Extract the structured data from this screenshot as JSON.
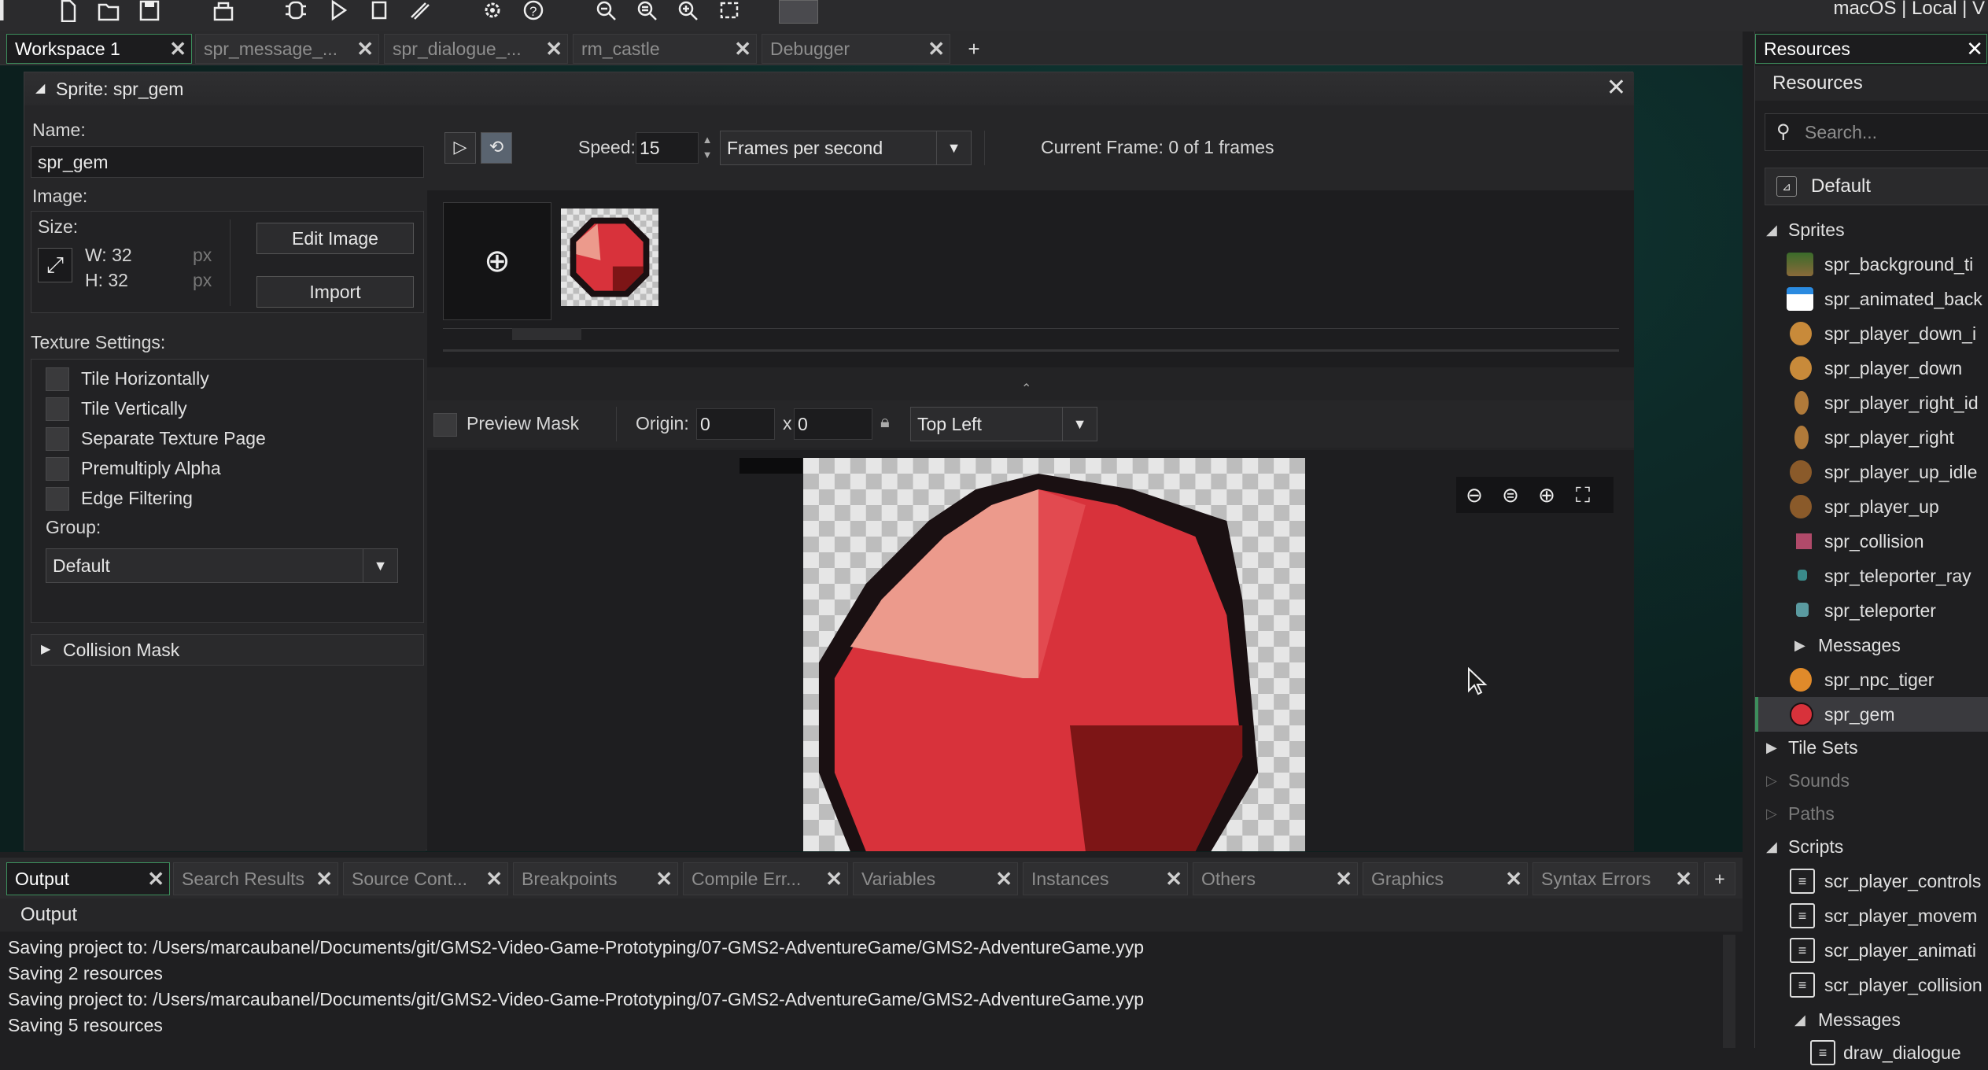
{
  "platform": "macOS | Local | V",
  "tabs": [
    {
      "label": "Workspace 1",
      "active": true
    },
    {
      "label": "spr_message_...",
      "active": false
    },
    {
      "label": "spr_dialogue_...",
      "active": false
    },
    {
      "label": "rm_castle",
      "active": false
    },
    {
      "label": "Debugger",
      "active": false
    }
  ],
  "tab_add": "+",
  "sprite": {
    "title": "Sprite: spr_gem",
    "name_label": "Name:",
    "name_value": "spr_gem",
    "image_label": "Image:",
    "size_label": "Size:",
    "width": "W: 32",
    "height": "H: 32",
    "unit": "px",
    "edit_image": "Edit Image",
    "import": "Import",
    "texture_label": "Texture Settings:",
    "texture_options": [
      "Tile Horizontally",
      "Tile Vertically",
      "Separate Texture Page",
      "Premultiply Alpha",
      "Edge Filtering"
    ],
    "group_label": "Group:",
    "group_value": "Default",
    "collision_mask": "Collision Mask",
    "speed_label": "Speed:",
    "speed_value": "15",
    "speed_unit": "Frames per second",
    "current_frame": "Current Frame: 0 of 1 frames",
    "preview_mask": "Preview Mask",
    "origin_label": "Origin:",
    "origin_x": "0",
    "origin_sep": "x",
    "origin_y": "0",
    "origin_preset": "Top Left"
  },
  "bottom_tabs": [
    {
      "label": "Output",
      "active": true
    },
    {
      "label": "Search Results",
      "active": false
    },
    {
      "label": "Source Cont...",
      "active": false
    },
    {
      "label": "Breakpoints",
      "active": false
    },
    {
      "label": "Compile Err...",
      "active": false
    },
    {
      "label": "Variables",
      "active": false
    },
    {
      "label": "Instances",
      "active": false
    },
    {
      "label": "Others",
      "active": false
    },
    {
      "label": "Graphics",
      "active": false
    },
    {
      "label": "Syntax Errors",
      "active": false
    }
  ],
  "output": {
    "title": "Output",
    "lines": [
      "Saving project to: /Users/marcaubanel/Documents/git/GMS2-Video-Game-Prototyping/07-GMS2-AdventureGame/GMS2-AdventureGame.yyp",
      "Saving 2 resources",
      "Saving project to: /Users/marcaubanel/Documents/git/GMS2-Video-Game-Prototyping/07-GMS2-AdventureGame/GMS2-AdventureGame.yyp",
      "Saving 5 resources"
    ]
  },
  "resources": {
    "tab": "Resources",
    "title": "Resources",
    "search_placeholder": "Search...",
    "default": "Default",
    "sprites_label": "Sprites",
    "sprites": [
      "spr_background_ti",
      "spr_animated_back",
      "spr_player_down_i",
      "spr_player_down",
      "spr_player_right_id",
      "spr_player_right",
      "spr_player_up_idle",
      "spr_player_up",
      "spr_collision",
      "spr_teleporter_ray",
      "spr_teleporter"
    ],
    "messages_label": "Messages",
    "sprites_after": [
      "spr_npc_tiger",
      "spr_gem"
    ],
    "tile_sets": "Tile Sets",
    "sounds": "Sounds",
    "paths": "Paths",
    "scripts_label": "Scripts",
    "scripts": [
      "scr_player_controls",
      "scr_player_movem",
      "scr_player_animati",
      "scr_player_collision"
    ],
    "scripts_messages": "Messages",
    "scripts_messages_items": [
      "draw_dialogue"
    ]
  }
}
